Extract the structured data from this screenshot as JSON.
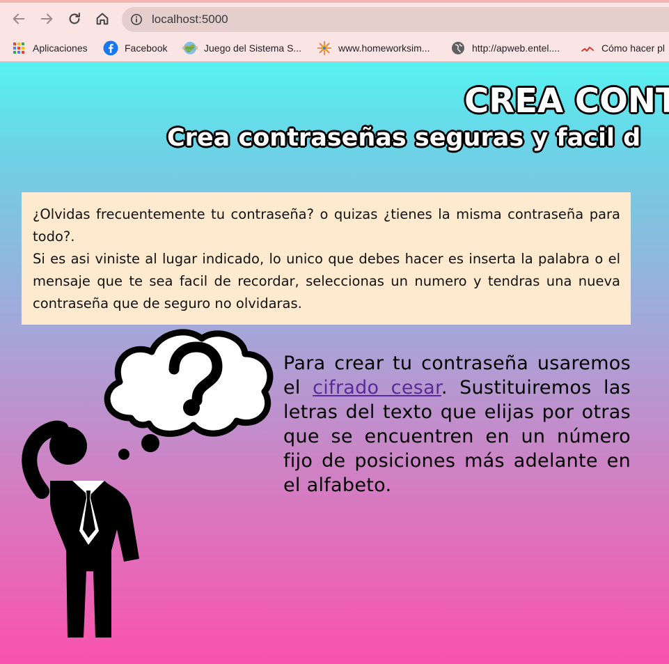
{
  "browser": {
    "url": "localhost:5000",
    "bookmarks": [
      {
        "label": "Aplicaciones",
        "icon": "apps-grid-icon"
      },
      {
        "label": "Facebook",
        "icon": "facebook-icon"
      },
      {
        "label": "Juego del Sistema S...",
        "icon": "globe-planet-icon"
      },
      {
        "label": "www.homeworksim...",
        "icon": "sun-icon"
      },
      {
        "label": "http://apweb.entel....",
        "icon": "globe-icon"
      },
      {
        "label": "Cómo hacer pl",
        "icon": "chart-line-icon"
      }
    ]
  },
  "page": {
    "title": "CREA CONT",
    "subtitle": "Crea contraseñas seguras y facil d",
    "intro_p1": "¿Olvidas frecuentemente tu contraseña? o quizas ¿tienes la misma contraseña para todo?.",
    "intro_p2": "Si es asi viniste al lugar indicado, lo unico que debes hacer es inserta la palabra o el mensaje que te sea facil de recordar, seleccionas un numero y tendras una nueva contraseña que de seguro no olvidaras.",
    "desc_before": "Para crear tu contraseña usaremos el ",
    "desc_link": "cifrado cesar",
    "desc_after": ". Sustituiremos las letras del texto que elijas por otras que se encuentren en un número fijo de posiciones más adelante en el alfabeto."
  }
}
